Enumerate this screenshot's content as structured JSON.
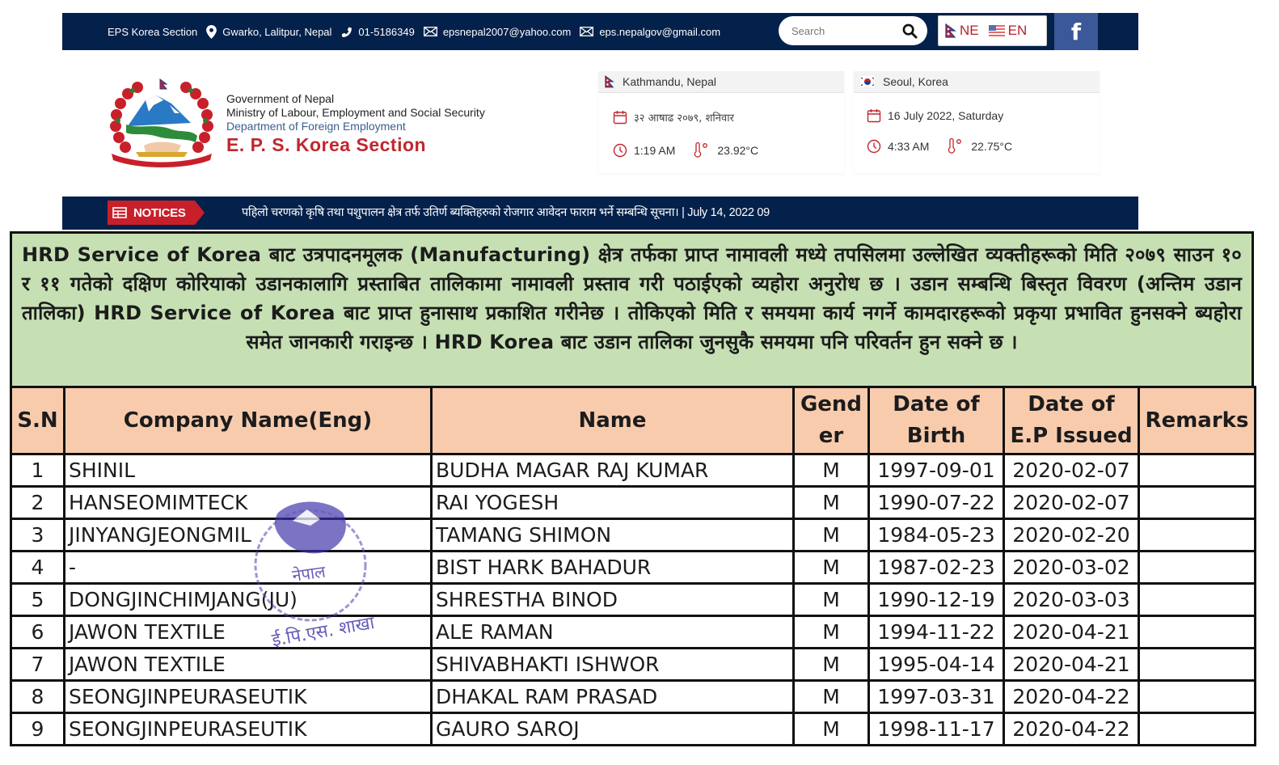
{
  "topbar": {
    "site_name": "EPS Korea Section",
    "address": "Gwarko, Lalitpur, Nepal",
    "phone": "01-5186349",
    "email1": "epsnepal2007@yahoo.com",
    "email2": "eps.nepalgov@gmail.com",
    "search_placeholder": "Search",
    "lang_ne": "NE",
    "lang_en": "EN",
    "facebook": "f",
    "colors": {
      "bar": "#03214a",
      "facebook": "#3b5998",
      "accent": "#c1272d"
    }
  },
  "header": {
    "line1": "Government of Nepal",
    "line2": "Ministry of Labour, Employment and Social Security",
    "line3": "Department of Foreign Employment",
    "line4": "E. P. S. Korea Section"
  },
  "cities": {
    "nepal": {
      "name": "Kathmandu, Nepal",
      "date": "३२ आषाढ २०७९, शनिवार",
      "time": "1:19 AM",
      "temp": "23.92°C"
    },
    "korea": {
      "name": "Seoul, Korea",
      "date": "16 July 2022, Saturday",
      "time": "4:33 AM",
      "temp": "22.75°C"
    }
  },
  "notices": {
    "label": "NOTICES",
    "ticker": "पहिलो चरणको कृषि तथा पशुपालन क्षेत्र तर्फ उतिर्ण ब्यक्तिहरुको रोजगार आवेदन फाराम भर्ने सम्बन्धि सूचना। | July 14, 2022 09"
  },
  "document": {
    "intro": "HRD Service of Korea बाट उत्रपादनमूलक (Manufacturing) क्षेत्र तर्फका प्राप्त नामावली मध्ये तपसिलमा उल्लेखित व्यक्तीहरूको मिति २०७९ साउन १० र ११ गतेको दक्षिण कोरियाको उडानकालागि प्रस्ताबित तालिकामा नामावली प्रस्ताव गरी पठाईएको व्यहोरा अनुरोध छ । उडान सम्बन्धि बिस्तृत विवरण (अन्तिम उडान तालिका) HRD Service of Korea बाट प्राप्त हुनासाथ प्रकाशित गरीनेछ । तोकिएको मिति र समयमा कार्य नगर्ने कामदारहरूको प्रकृया प्रभावित हुनसक्ने ब्यहोरा समेत जानकारी गराइन्छ । HRD Korea बाट उडान तालिका जुनसुकै समयमा पनि परिवर्तन हुन सक्ने छ ।",
    "columns": {
      "sn": "S.N",
      "company": "Company Name(Eng)",
      "name": "Name",
      "gender": "Gend er",
      "dob": "Date of Birth",
      "ep": "Date of E.P Issued",
      "remarks": "Remarks"
    },
    "rows": [
      {
        "sn": "1",
        "company": "SHINIL",
        "name": "BUDHA MAGAR RAJ KUMAR",
        "gender": "M",
        "dob": "1997-09-01",
        "ep": "2020-02-07",
        "remarks": ""
      },
      {
        "sn": "2",
        "company": "HANSEOMIMTECK",
        "name": "RAI YOGESH",
        "gender": "M",
        "dob": "1990-07-22",
        "ep": "2020-02-07",
        "remarks": ""
      },
      {
        "sn": "3",
        "company": "JINYANGJEONGMIL",
        "name": "TAMANG SHIMON",
        "gender": "M",
        "dob": "1984-05-23",
        "ep": "2020-02-20",
        "remarks": ""
      },
      {
        "sn": "4",
        "company": "-",
        "name": "BIST HARK BAHADUR",
        "gender": "M",
        "dob": "1987-02-23",
        "ep": "2020-03-02",
        "remarks": ""
      },
      {
        "sn": "5",
        "company": "DONGJINCHIMJANG(JU)",
        "name": "SHRESTHA BINOD",
        "gender": "M",
        "dob": "1990-12-19",
        "ep": "2020-03-03",
        "remarks": ""
      },
      {
        "sn": "6",
        "company": "JAWON TEXTILE",
        "name": "ALE RAMAN",
        "gender": "M",
        "dob": "1994-11-22",
        "ep": "2020-04-21",
        "remarks": ""
      },
      {
        "sn": "7",
        "company": "JAWON TEXTILE",
        "name": "SHIVABHAKTI ISHWOR",
        "gender": "M",
        "dob": "1995-04-14",
        "ep": "2020-04-21",
        "remarks": ""
      },
      {
        "sn": "8",
        "company": "SEONGJINPEURASEUTIK",
        "name": "DHAKAL RAM PRASAD",
        "gender": "M",
        "dob": "1997-03-31",
        "ep": "2020-04-22",
        "remarks": ""
      },
      {
        "sn": "9",
        "company": "SEONGJINPEURASEUTIK",
        "name": "GAURO SAROJ",
        "gender": "M",
        "dob": "1998-11-17",
        "ep": "2020-04-22",
        "remarks": ""
      }
    ],
    "stamp_text": "ई.पि.एस. शाखा",
    "stamp_text_upper": "नेपाल"
  }
}
